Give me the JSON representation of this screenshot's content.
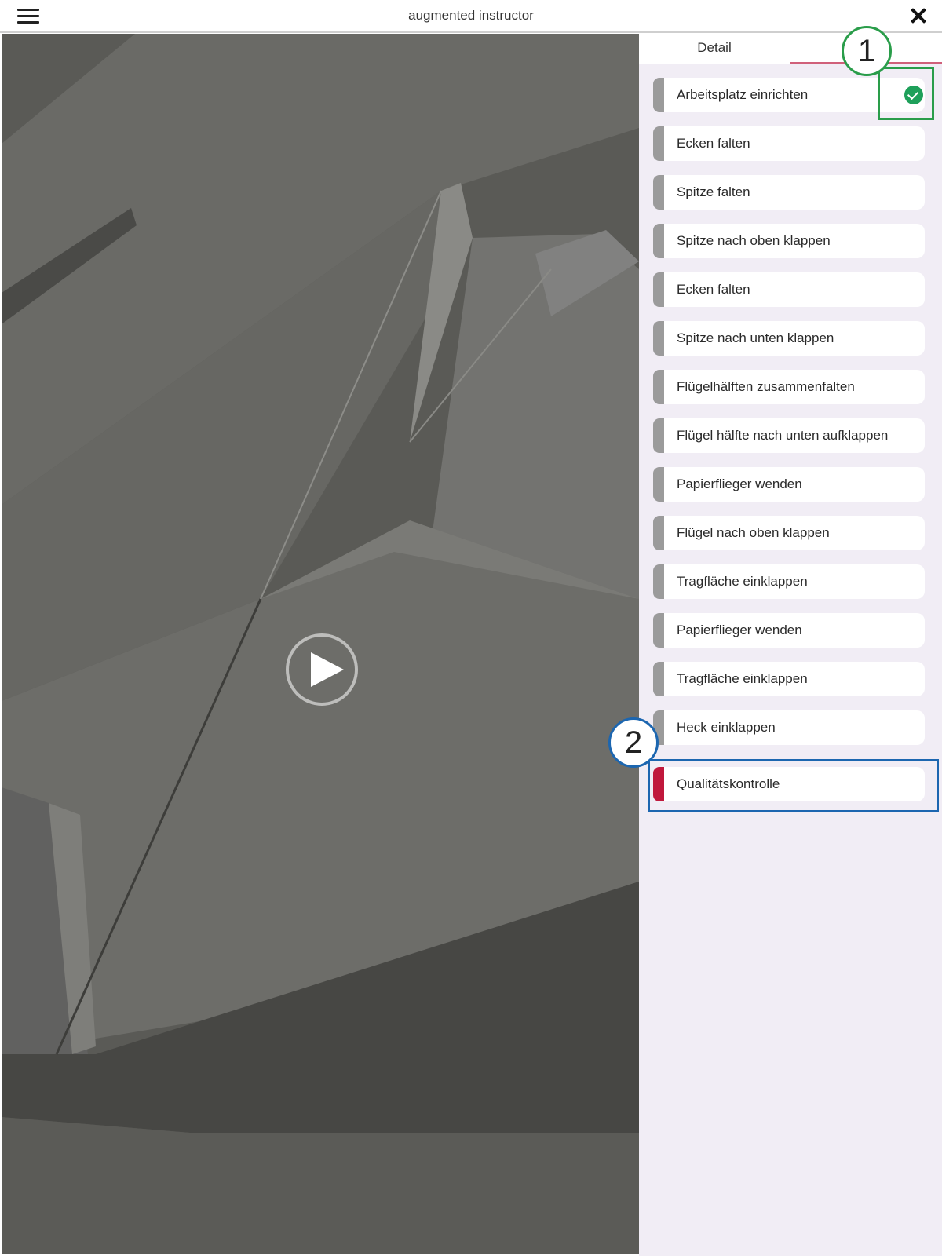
{
  "header": {
    "title": "augmented instructor"
  },
  "tabs": {
    "detail_label": "Detail"
  },
  "steps": [
    {
      "label": "Arbeitsplatz einrichten",
      "done": true
    },
    {
      "label": "Ecken falten"
    },
    {
      "label": "Spitze falten"
    },
    {
      "label": "Spitze nach oben klappen"
    },
    {
      "label": "Ecken falten"
    },
    {
      "label": "Spitze nach unten klappen"
    },
    {
      "label": "Flügelhälften zusammenfalten"
    },
    {
      "label": "Flügel hälfte nach unten aufklappen"
    },
    {
      "label": "Papierflieger wenden"
    },
    {
      "label": "Flügel nach oben klappen"
    },
    {
      "label": "Tragfläche einklappen"
    },
    {
      "label": "Papierflieger wenden"
    },
    {
      "label": "Tragfläche einklappen"
    },
    {
      "label": "Heck einklappen"
    },
    {
      "label": "Qualitätskontrolle",
      "active": true
    }
  ],
  "annotations": {
    "marker_1": "1",
    "marker_2": "2"
  },
  "colors": {
    "active_step": "#c0183c",
    "inactive_step": "#9b9b9b",
    "done_check": "#1ea05a",
    "callout_1": "#2a9d4a",
    "callout_2": "#1c66b0",
    "tab_underline": "#d0607a",
    "panel_bg": "#f1edf5"
  },
  "icons": {
    "menu": "hamburger-menu-icon",
    "close": "close-icon",
    "play": "play-icon",
    "done": "checkmark-circle-icon"
  }
}
